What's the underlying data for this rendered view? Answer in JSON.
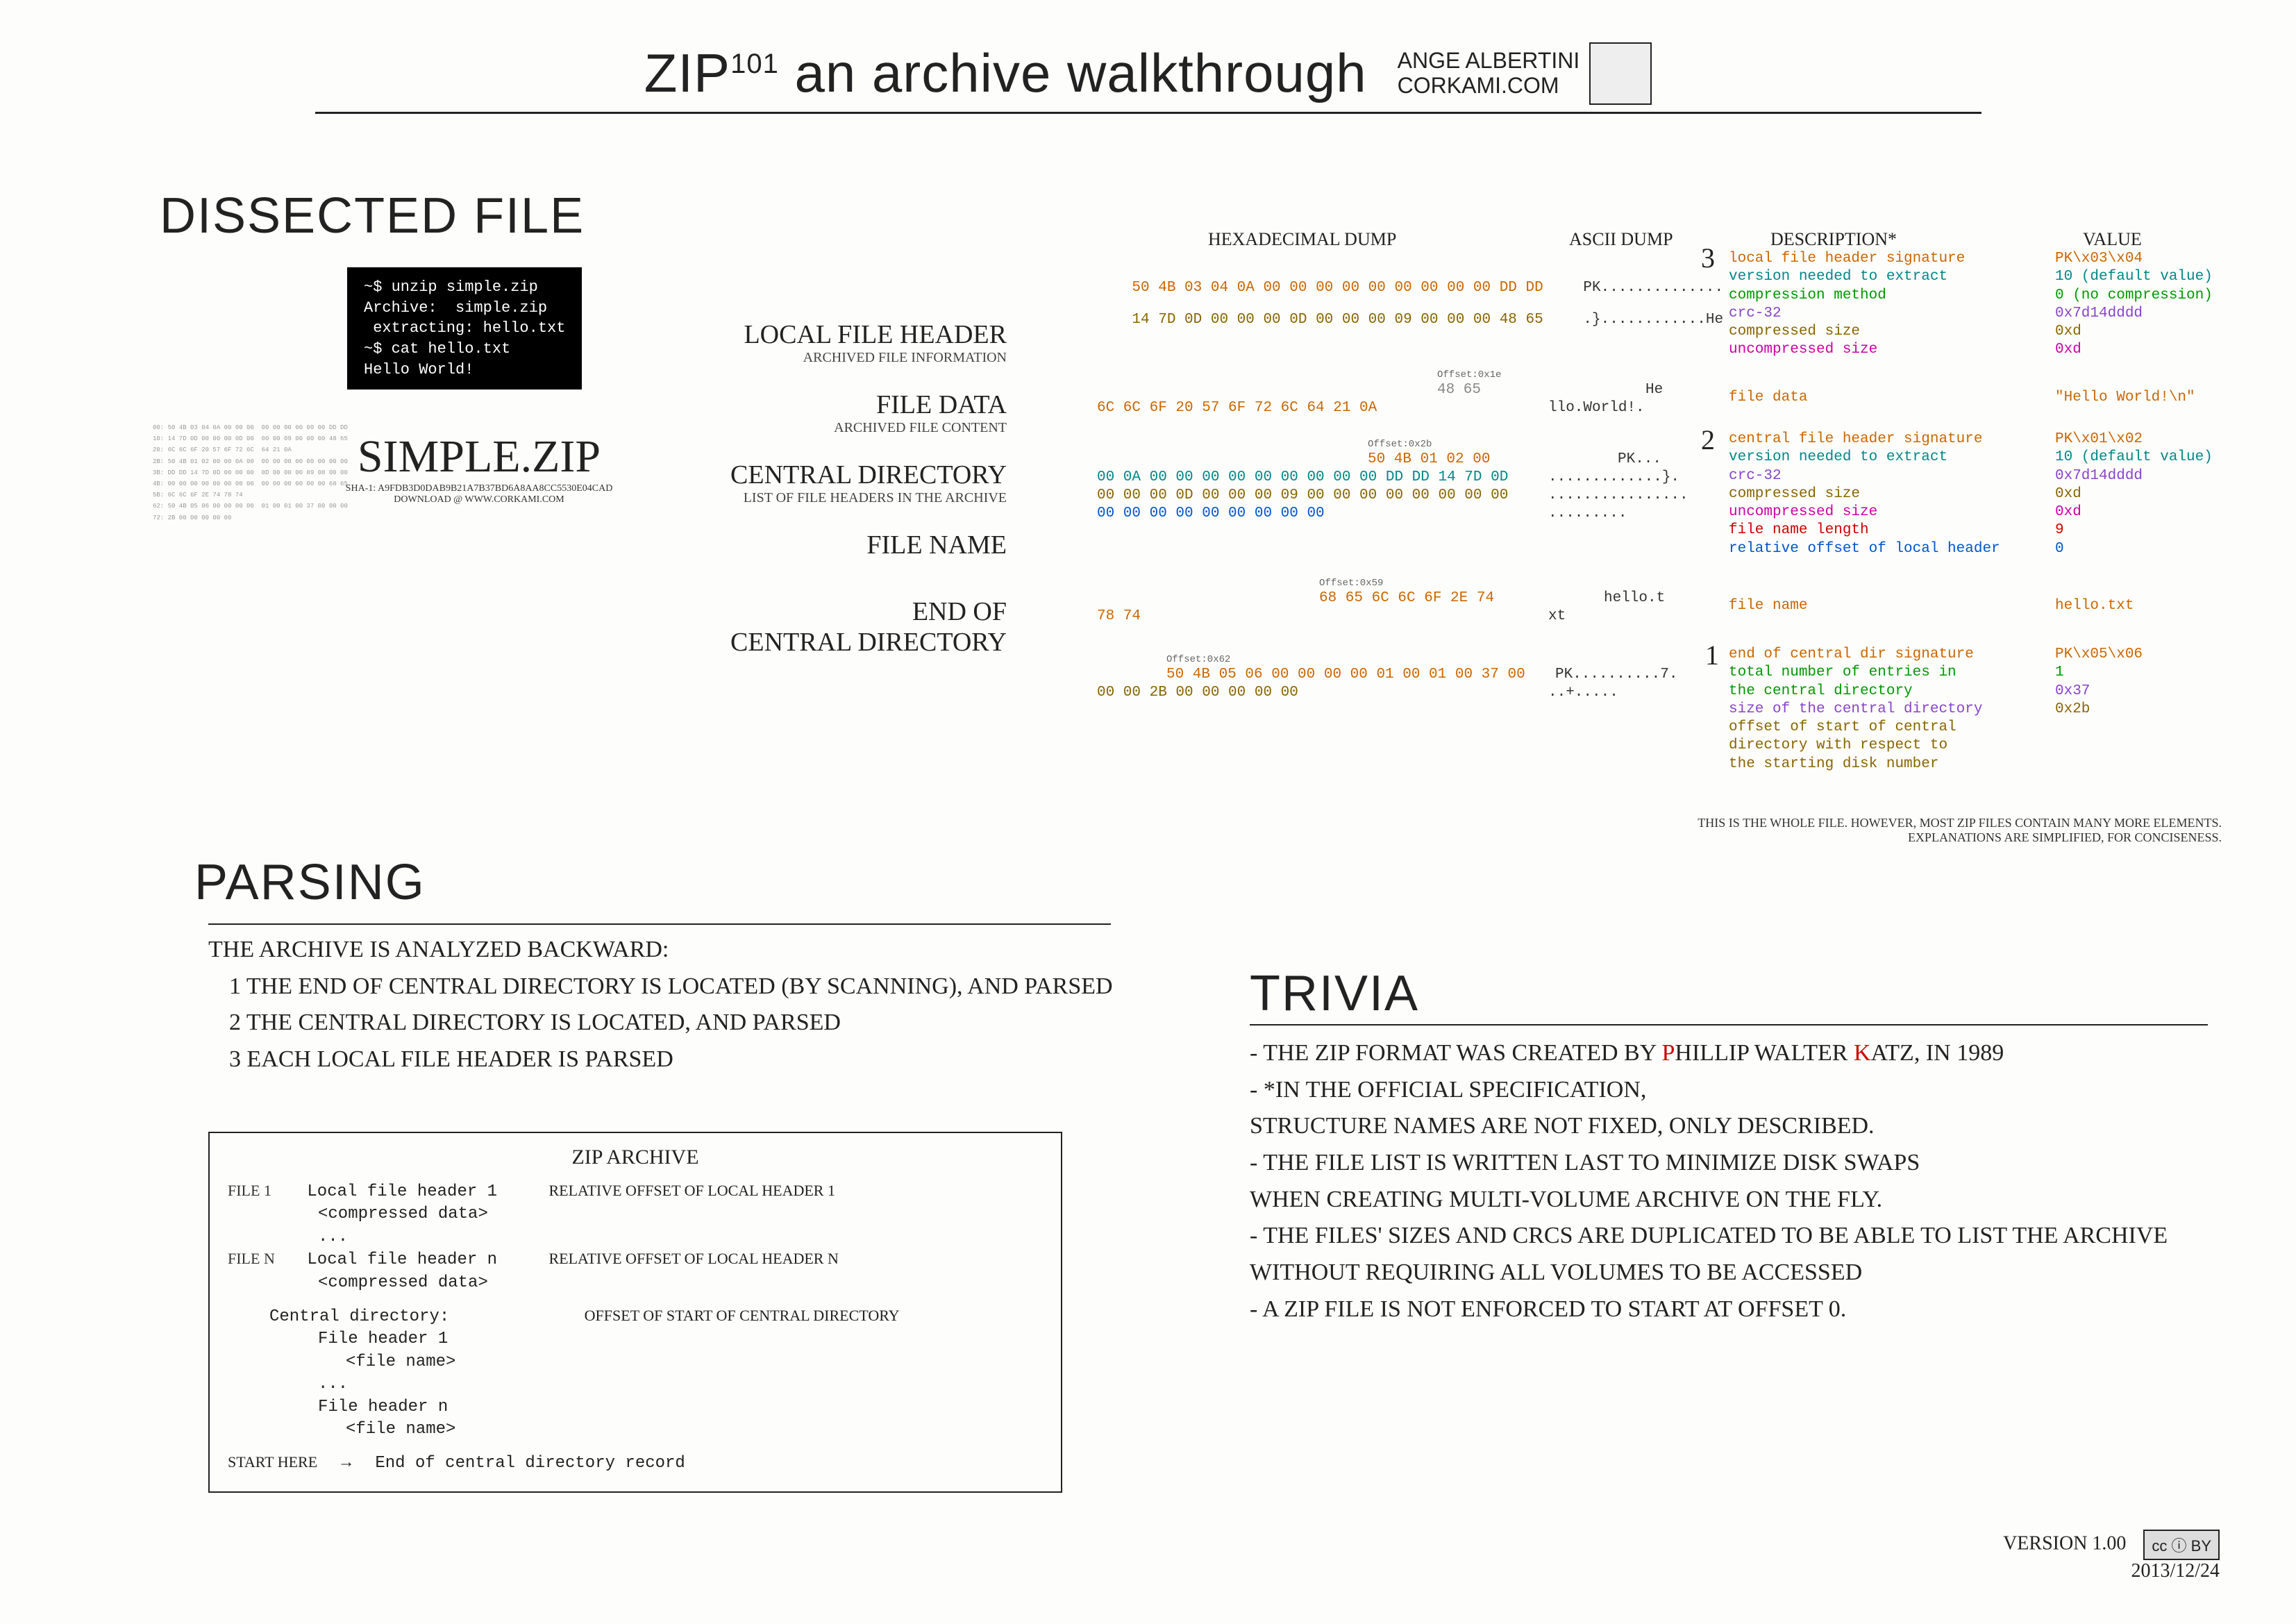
{
  "title": {
    "zip": "ZIP",
    "sup": "101",
    "rest": " an archive walkthrough",
    "author": "ANGE ALBERTINI",
    "site": "CORKAMI.COM"
  },
  "dissected_title": "DISSECTED FILE",
  "terminal": "~$ unzip simple.zip\nArchive:  simple.zip\n extracting: hello.txt\n~$ cat hello.txt\nHello World!",
  "simplezip": {
    "name": "SIMPLE.ZIP",
    "sha": "SHA-1: A9FDB3D0DAB9B21A7B37BD6A8AA8CC5530E04CAD",
    "download": "DOWNLOAD @ WWW.CORKAMI.COM"
  },
  "hex_backdrop": "00: 50 4B 03 04 0A 00 00 00  00 00 00 00 00 00 DD DD\n10: 14 7D 0D 00 00 00 0D 00  00 00 09 00 00 00 48 65\n20: 6C 6C 6F 20 57 6F 72 6C  64 21 0A              \n2B: 50 4B 01 02 00 00 0A 00  00 00 00 00 00 00 00 00\n3B: DD DD 14 7D 0D 00 00 00  0D 00 00 00 09 00 00 00\n4B: 00 00 00 00 00 00 00 00  00 00 00 00 00 00 68 65\n5B: 6C 6C 6F 2E 74 78 74                           \n62: 50 4B 05 06 00 00 00 00  01 00 01 00 37 00 00 00\n72: 2B 00 00 00 00 00",
  "sections": [
    {
      "label": "LOCAL FILE HEADER",
      "sub": "ARCHIVED FILE INFORMATION"
    },
    {
      "label": "FILE DATA",
      "sub": "ARCHIVED FILE CONTENT"
    },
    {
      "label": "CENTRAL DIRECTORY",
      "sub": "LIST OF FILE HEADERS IN THE ARCHIVE"
    },
    {
      "label": "FILE NAME",
      "sub": ""
    },
    {
      "label": "END OF\nCENTRAL DIRECTORY",
      "sub": ""
    }
  ],
  "dump_headers": {
    "hex": "HEXADECIMAL DUMP",
    "ascii": "ASCII DUMP",
    "desc": "DESCRIPTION*",
    "val": "VALUE"
  },
  "lfh": {
    "step": "3",
    "hex_l1": "50 4B 03 04 0A 00 00 00 00 00 00 00 00 00 DD DD",
    "hex_l2": "14 7D 0D 00 00 00 0D 00 00 00 09 00 00 00 48 65",
    "ascii_l1": "PK..............",
    "ascii_l2": ".}............He",
    "desc": [
      {
        "t": "local file header signature",
        "c": "c-orange"
      },
      {
        "t": "version needed to extract",
        "c": "c-teal"
      },
      {
        "t": "compression method",
        "c": "c-green"
      },
      {
        "t": "crc-32",
        "c": "c-purple"
      },
      {
        "t": "compressed size",
        "c": "c-brown"
      },
      {
        "t": "uncompressed size",
        "c": "c-magenta"
      }
    ],
    "val": [
      {
        "t": "PK\\x03\\x04",
        "c": "c-orange"
      },
      {
        "t": "10 (default value)",
        "c": "c-teal"
      },
      {
        "t": "0 (no compression)",
        "c": "c-green"
      },
      {
        "t": "0x7d14dddd",
        "c": "c-purple"
      },
      {
        "t": "0xd",
        "c": "c-brown"
      },
      {
        "t": "0xd",
        "c": "c-magenta"
      }
    ]
  },
  "filedata": {
    "offset": "Offset:0x1e",
    "hex_prev": "48 65",
    "hex": "6C 6C 6F 20 57 6F 72 6C 64 21 0A",
    "ascii_prev": "He",
    "ascii": "llo.World!.",
    "desc": "file data",
    "val": "\"Hello World!\\n\""
  },
  "cdir": {
    "step": "2",
    "offset": "Offset:0x2b",
    "hex_l0": "50 4B 01 02 00",
    "hex_l1": "00 0A 00 00 00 00 00 00 00 00 00 DD DD 14 7D 0D",
    "hex_l2": "00 00 00 0D 00 00 00 09 00 00 00 00 00 00 00 00",
    "hex_l3": "00 00 00 00 00 00 00 00 00",
    "ascii_l0": "PK...",
    "ascii_l1": ".............}.",
    "ascii_l2": "................",
    "ascii_l3": ".........",
    "desc": [
      {
        "t": "central file header signature",
        "c": "c-orange"
      },
      {
        "t": "version needed to extract",
        "c": "c-teal"
      },
      {
        "t": "crc-32",
        "c": "c-purple"
      },
      {
        "t": "compressed size",
        "c": "c-brown"
      },
      {
        "t": "uncompressed size",
        "c": "c-magenta"
      },
      {
        "t": "file name length",
        "c": "c-red"
      },
      {
        "t": "relative offset of local header",
        "c": "c-blue"
      }
    ],
    "val": [
      {
        "t": "PK\\x01\\x02",
        "c": "c-orange"
      },
      {
        "t": "10 (default value)",
        "c": "c-teal"
      },
      {
        "t": "0x7d14dddd",
        "c": "c-purple"
      },
      {
        "t": "0xd",
        "c": "c-brown"
      },
      {
        "t": "0xd",
        "c": "c-magenta"
      },
      {
        "t": "9",
        "c": "c-red"
      },
      {
        "t": "0",
        "c": "c-blue"
      }
    ]
  },
  "fname": {
    "offset": "Offset:0x59",
    "hex_prev": "68 65 6C 6C 6F 2E 74",
    "hex": "78 74",
    "ascii_prev": "hello.t",
    "ascii": "xt",
    "desc": "file name",
    "val": "hello.txt"
  },
  "eocd": {
    "step": "1",
    "offset": "Offset:0x62",
    "hex_l1": "50 4B 05 06 00 00 00 00 01 00 01 00 37 00",
    "hex_l2": "00 00 2B 00 00 00 00 00",
    "ascii_l1": "PK..........7.",
    "ascii_l2": "..+.....",
    "desc": [
      {
        "t": "end of central dir signature",
        "c": "c-orange"
      },
      {
        "t": "total number of entries in",
        "c": "c-green"
      },
      {
        "t": "   the central directory",
        "c": "c-green"
      },
      {
        "t": "size of the central directory",
        "c": "c-purple"
      },
      {
        "t": "offset of start of central",
        "c": "c-brown"
      },
      {
        "t": "   directory with respect to",
        "c": "c-brown"
      },
      {
        "t": "   the starting disk number",
        "c": "c-brown"
      }
    ],
    "val": [
      {
        "t": "PK\\x05\\x06",
        "c": "c-orange"
      },
      {
        "t": "1",
        "c": "c-green"
      },
      {
        "t": "",
        "c": ""
      },
      {
        "t": "0x37",
        "c": "c-purple"
      },
      {
        "t": "0x2b",
        "c": "c-brown"
      }
    ]
  },
  "disclaimer": "THIS IS THE WHOLE FILE. HOWEVER, MOST ZIP FILES CONTAIN MANY MORE ELEMENTS.\nEXPLANATIONS ARE SIMPLIFIED, FOR CONCISENESS.",
  "parsing": {
    "title": "PARSING",
    "lead": "THE ARCHIVE IS ANALYZED BACKWARD:",
    "items": [
      "1 THE END OF CENTRAL DIRECTORY IS LOCATED (BY SCANNING), AND PARSED",
      "2 THE CENTRAL DIRECTORY IS LOCATED, AND PARSED",
      "3 EACH LOCAL FILE HEADER IS PARSED"
    ]
  },
  "archive": {
    "title": "ZIP ARCHIVE",
    "file1_label": "FILE 1",
    "file1_a": "Local file header 1",
    "file1_b": "<compressed data>",
    "off1": "RELATIVE OFFSET OF LOCAL HEADER 1",
    "filen_label": "FILE N",
    "filen_a": "Local file header n",
    "filen_b": "<compressed data>",
    "offn": "RELATIVE OFFSET OF LOCAL HEADER N",
    "dots": "...",
    "cd": "Central directory:",
    "cd1a": "File header 1",
    "cd1b": "<file name>",
    "cdna": "File header n",
    "cdnb": "<file name>",
    "offcd": "OFFSET OF START OF CENTRAL DIRECTORY",
    "start": "START HERE",
    "eocd": "End of central directory record"
  },
  "trivia": {
    "title": "TRIVIA",
    "lines": [
      "- THE ZIP FORMAT WAS CREATED BY |P|HILLIP WALTER |K|ATZ, IN 1989",
      "- *IN THE OFFICIAL SPECIFICATION,",
      "  STRUCTURE NAMES ARE NOT FIXED, ONLY DESCRIBED.",
      "- THE FILE LIST IS WRITTEN LAST TO MINIMIZE DISK SWAPS",
      "  WHEN CREATING MULTI-VOLUME ARCHIVE ON THE FLY.",
      "- THE FILES' SIZES AND CRCS ARE DUPLICATED TO BE ABLE TO LIST THE ARCHIVE",
      "  WITHOUT REQUIRING ALL VOLUMES TO BE ACCESSED",
      "- A ZIP FILE IS NOT ENFORCED TO START AT OFFSET 0."
    ]
  },
  "footer": {
    "version": "VERSION 1.00",
    "date": "2013/12/24",
    "cc": "cc  ⓘ  BY"
  }
}
